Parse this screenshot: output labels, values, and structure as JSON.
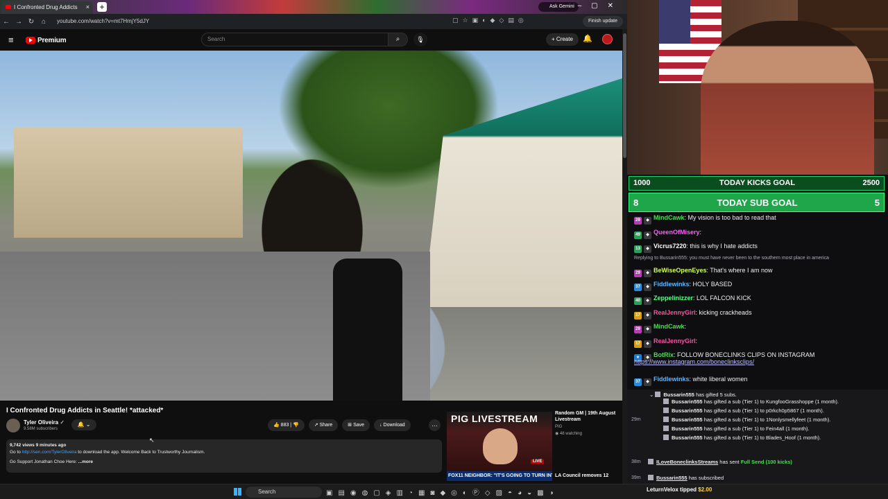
{
  "browser": {
    "tab_title": "I Confronted Drug Addicts",
    "ask_gemini": "Ask Gemini",
    "url": "youtube.com/watch?v=mt7HmjY5dJY",
    "finish_update": "Finish update"
  },
  "youtube": {
    "logo_text": "Premium",
    "search_placeholder": "Search",
    "create_label": "Create",
    "video": {
      "title": "I Confronted Drug Addicts in Seattle! *attacked*",
      "channel": "Tyler Oliveira",
      "subscribers": "9.58M subscribers",
      "likes": "883",
      "share": "Share",
      "save": "Save",
      "download": "Download",
      "description_meta": "9,742 views  9 minutes ago",
      "description_line1_prefix": "Go to ",
      "description_link": "http://sen.com/TylerOliveira",
      "description_line1_suffix": " to download the app. Welcome Back to Trustworthy Journalism.",
      "description_line2": "Go Support Jonathan Choe Here:",
      "description_more": " ...more"
    },
    "recommendation": {
      "thumb_title": "PIG LIVESTREAM",
      "thumb_live": "LIVE",
      "thumb_banner": "FOX11 NEIGHBOR: \"IT'S GOING TO TURN INTO SKID ROW\"",
      "title": "Random GM | 19th August Livestream",
      "channel": "PIG",
      "watching": "48 watching",
      "title2": "LA Council removes 12"
    }
  },
  "stream": {
    "goal1": {
      "left": "1000",
      "label": "TODAY KICKS GOAL",
      "right": "2500"
    },
    "goal2": {
      "left": "8",
      "label": "TODAY SUB GOAL",
      "right": "5"
    },
    "chat": [
      {
        "badge": "29",
        "badge_color": "#b23fb0",
        "user": "MindCawk",
        "color": "#4ddc58",
        "text": ": My vision is too bad to read that"
      },
      {
        "badge": "49",
        "badge_color": "#2e9c5a",
        "user": "QueenOfMisery",
        "color": "#ff5bff",
        "text": ":"
      },
      {
        "badge": "13",
        "badge_color": "#2e9c5a",
        "user": "Vicrus7220",
        "color": "#ffffff",
        "text": ": this is why I hate addicts"
      },
      {
        "badge": "29",
        "badge_color": "#b23fb0",
        "user": "BeWiseOpenEyes",
        "color": "#d4ff5c",
        "text": ": That's where I am now"
      },
      {
        "badge": "37",
        "badge_color": "#2a8bd6",
        "user": "Fiddlewinks",
        "color": "#5cb7ff",
        "text": ": HOLY BASED"
      },
      {
        "badge": "40",
        "badge_color": "#2e9c5a",
        "user": "Zeppelinizzer",
        "color": "#5bff8e",
        "text": ": LOL FALCON KICK"
      },
      {
        "badge": "17",
        "badge_color": "#d4a017",
        "user": "RealJennyGirl",
        "color": "#ff4fa3",
        "text": ": kicking crackheads"
      },
      {
        "badge": "29",
        "badge_color": "#b23fb0",
        "user": "MindCawk",
        "color": "#4ddc58",
        "text": ":"
      },
      {
        "badge": "17",
        "badge_color": "#d4a017",
        "user": "RealJennyGirl",
        "color": "#ff4fa3",
        "text": ":"
      },
      {
        "badge": "★",
        "badge_color": "#1f7ad6",
        "user": "BotRix",
        "color": "#4ddc58",
        "text": ": FOLLOW BONECLINKS CLIPS ON INSTAGRAM"
      },
      {
        "badge": "37",
        "badge_color": "#2a8bd6",
        "user": "Fiddlewinks",
        "color": "#5cb7ff",
        "text": ": white liberal women"
      }
    ],
    "reply_note": "Replying to Bussarin555: you must have never been to the southern most place in america",
    "instagram_link": "https://www.instagram.com/boneclinksclips/",
    "gifts": {
      "header_user": "Bussarin555",
      "header_text": " has gifted 5 subs.",
      "timestamp": "29m",
      "rows": [
        {
          "user": "Bussarin555",
          "text": " has gifted a sub (Tier 1) to KungfooGrasshoppe (1 month)."
        },
        {
          "user": "Bussarin555",
          "text": " has gifted a sub (Tier 1) to p0rkch0p5867 (1 month)."
        },
        {
          "user": "Bussarin555",
          "text": " has gifted a sub (Tier 1) to 1Nonlysmellyfeet (1 month)."
        },
        {
          "user": "Bussarin555",
          "text": " has gifted a sub (Tier 1) to Fein4all (1 month)."
        },
        {
          "user": "Bussarin555",
          "text": " has gifted a sub (Tier 1) to Blades_Hoof (1 month)."
        }
      ],
      "send_ts": "38m",
      "send_user": "ILoveBoneclinksStreams",
      "send_text": " has sent ",
      "send_item": "Full Send (100 kicks)",
      "subscribed_ts": "39m",
      "subscribed_user": "Bussarin555",
      "subscribed_text": " has subscribed",
      "tip_user": "LeturnVelox",
      "tip_text": "tipped",
      "tip_amount": "$2.00"
    }
  },
  "taskbar": {
    "search_label": "Search"
  }
}
